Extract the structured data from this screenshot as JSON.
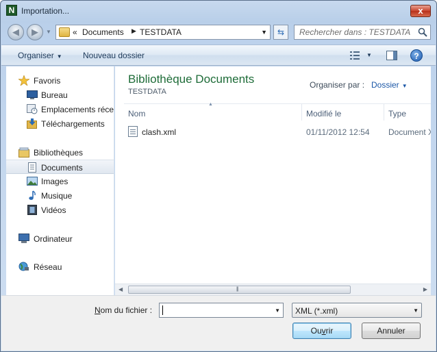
{
  "window": {
    "title": "Importation...",
    "app_icon_letter": "N",
    "close_label": "x"
  },
  "address_bar": {
    "prefix": "«",
    "crumbs": [
      "Documents",
      "TESTDATA"
    ],
    "search_placeholder": "Rechercher dans : TESTDATA"
  },
  "toolbar": {
    "organize_label": "Organiser",
    "new_folder_label": "Nouveau dossier",
    "help_label": "?"
  },
  "navigation": {
    "favorites": {
      "label": "Favoris",
      "items": [
        "Bureau",
        "Emplacements récents",
        "Téléchargements"
      ]
    },
    "libraries": {
      "label": "Bibliothèques",
      "items": [
        "Documents",
        "Images",
        "Musique",
        "Vidéos"
      ],
      "selected": "Documents"
    },
    "computer_label": "Ordinateur",
    "network_label": "Réseau"
  },
  "content": {
    "library_title": "Bibliothèque Documents",
    "library_subtitle": "TESTDATA",
    "arrange_by_label": "Organiser par :",
    "arrange_by_value": "Dossier",
    "columns": [
      "Nom",
      "Modifié le",
      "Type"
    ],
    "files": [
      {
        "name": "clash.xml",
        "modified": "01/11/2012 12:54",
        "type": "Document XML"
      }
    ]
  },
  "footer": {
    "filename_label_underlined": "N",
    "filename_label_rest": "om du fichier :",
    "filename_value": "",
    "filetype_value": "XML (*.xml)",
    "open_label_pre": "Ou",
    "open_label_underlined": "v",
    "open_label_post": "rir",
    "cancel_label": "Annuler"
  },
  "colors": {
    "library_title": "#1e6c38",
    "link_blue": "#1a56a6",
    "window_frame": "#b9cfe9"
  }
}
